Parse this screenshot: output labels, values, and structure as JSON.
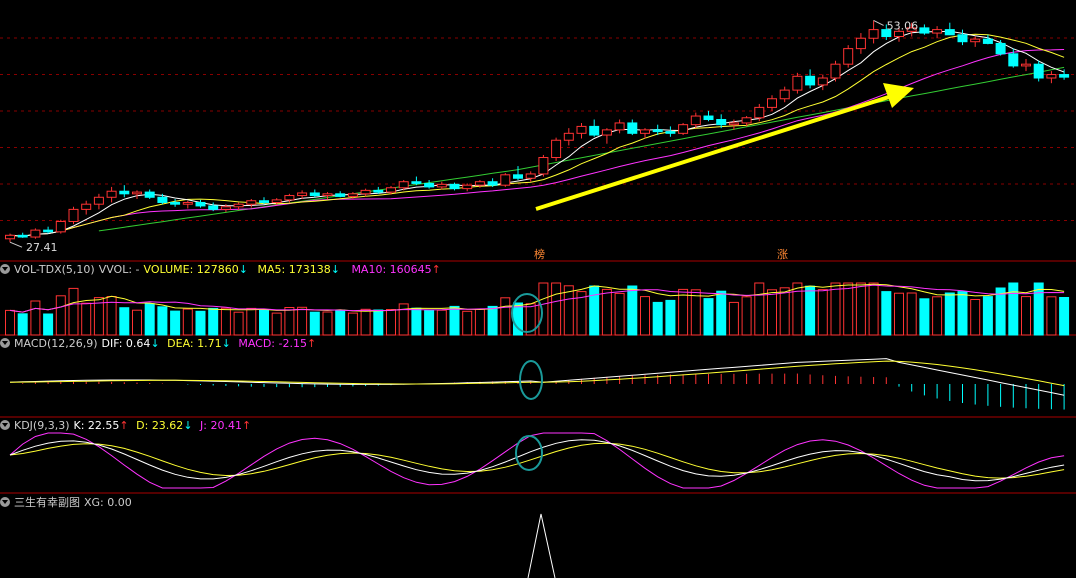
{
  "colors": {
    "up": "#ff3333",
    "down": "#00ffff",
    "ma5": "#ffffff",
    "ma10": "#ffff33",
    "ma20": "#ff33ff",
    "ma60": "#33cc33",
    "arrow": "#ffff00",
    "circle": "#1a9a9a",
    "divider": "#aa0000"
  },
  "price": {
    "high_label": "53.06",
    "low_label": "27.41",
    "markers": [
      "榜",
      "涨"
    ],
    "candles": [
      [
        27.8,
        28.4,
        27.4,
        28.2
      ],
      [
        28.2,
        28.5,
        27.9,
        28.0
      ],
      [
        28.0,
        29.0,
        27.8,
        28.8
      ],
      [
        28.8,
        29.2,
        28.4,
        28.6
      ],
      [
        28.6,
        30.0,
        28.4,
        29.8
      ],
      [
        29.8,
        31.5,
        29.5,
        31.2
      ],
      [
        31.2,
        32.2,
        30.6,
        31.8
      ],
      [
        31.8,
        33.0,
        31.2,
        32.6
      ],
      [
        32.6,
        33.8,
        32.0,
        33.3
      ],
      [
        33.3,
        34.0,
        32.6,
        33.0
      ],
      [
        33.0,
        33.4,
        32.4,
        33.2
      ],
      [
        33.2,
        33.5,
        32.4,
        32.6
      ],
      [
        32.6,
        33.0,
        31.8,
        32.0
      ],
      [
        32.0,
        32.4,
        31.5,
        31.8
      ],
      [
        31.8,
        32.2,
        31.3,
        32.0
      ],
      [
        32.0,
        32.3,
        31.4,
        31.6
      ],
      [
        31.6,
        32.0,
        31.0,
        31.2
      ],
      [
        31.2,
        31.8,
        30.9,
        31.5
      ],
      [
        31.5,
        32.0,
        31.1,
        31.8
      ],
      [
        31.8,
        32.4,
        31.4,
        32.2
      ],
      [
        32.2,
        32.6,
        31.8,
        32.0
      ],
      [
        32.0,
        32.5,
        31.7,
        32.3
      ],
      [
        32.3,
        33.0,
        32.0,
        32.8
      ],
      [
        32.8,
        33.4,
        32.4,
        33.1
      ],
      [
        33.1,
        33.5,
        32.6,
        32.8
      ],
      [
        32.8,
        33.2,
        32.4,
        33.0
      ],
      [
        33.0,
        33.3,
        32.6,
        32.7
      ],
      [
        32.7,
        33.2,
        32.4,
        33.0
      ],
      [
        33.0,
        33.6,
        32.7,
        33.4
      ],
      [
        33.4,
        33.8,
        33.0,
        33.2
      ],
      [
        33.2,
        33.9,
        32.9,
        33.7
      ],
      [
        33.7,
        34.6,
        33.4,
        34.4
      ],
      [
        34.4,
        35.0,
        34.0,
        34.2
      ],
      [
        34.2,
        34.6,
        33.6,
        33.8
      ],
      [
        33.8,
        34.4,
        33.5,
        34.1
      ],
      [
        34.1,
        34.3,
        33.4,
        33.6
      ],
      [
        33.6,
        34.2,
        33.3,
        34.0
      ],
      [
        34.0,
        34.6,
        33.7,
        34.4
      ],
      [
        34.4,
        34.8,
        33.8,
        34.0
      ],
      [
        34.0,
        35.4,
        33.8,
        35.2
      ],
      [
        35.2,
        36.2,
        34.6,
        34.8
      ],
      [
        34.8,
        35.6,
        34.4,
        35.3
      ],
      [
        35.3,
        37.5,
        35.0,
        37.2
      ],
      [
        37.2,
        39.5,
        36.8,
        39.2
      ],
      [
        39.2,
        40.6,
        38.6,
        40.0
      ],
      [
        40.0,
        41.2,
        39.4,
        40.8
      ],
      [
        40.8,
        41.6,
        39.6,
        39.8
      ],
      [
        39.8,
        40.6,
        38.8,
        40.4
      ],
      [
        40.4,
        41.6,
        40.0,
        41.2
      ],
      [
        41.2,
        41.6,
        39.8,
        40.0
      ],
      [
        40.0,
        40.6,
        39.4,
        40.4
      ],
      [
        40.4,
        41.0,
        39.8,
        40.2
      ],
      [
        40.2,
        40.8,
        39.6,
        40.0
      ],
      [
        40.0,
        41.2,
        39.8,
        41.0
      ],
      [
        41.0,
        42.4,
        40.6,
        42.0
      ],
      [
        42.0,
        42.6,
        41.4,
        41.6
      ],
      [
        41.6,
        42.2,
        40.6,
        41.0
      ],
      [
        41.0,
        41.6,
        40.4,
        41.2
      ],
      [
        41.2,
        42.0,
        40.8,
        41.8
      ],
      [
        41.8,
        43.4,
        41.4,
        43.0
      ],
      [
        43.0,
        44.4,
        42.6,
        44.0
      ],
      [
        44.0,
        45.4,
        43.6,
        45.0
      ],
      [
        45.0,
        47.0,
        44.6,
        46.6
      ],
      [
        46.6,
        47.4,
        45.2,
        45.6
      ],
      [
        45.6,
        46.8,
        45.0,
        46.4
      ],
      [
        46.4,
        48.4,
        46.0,
        48.0
      ],
      [
        48.0,
        50.2,
        47.6,
        49.8
      ],
      [
        49.8,
        51.6,
        49.2,
        51.0
      ],
      [
        51.0,
        53.06,
        50.4,
        52.0
      ],
      [
        52.0,
        52.6,
        50.8,
        51.2
      ],
      [
        51.2,
        52.2,
        50.6,
        51.8
      ],
      [
        51.8,
        52.8,
        51.2,
        52.2
      ],
      [
        52.2,
        52.6,
        51.4,
        51.6
      ],
      [
        51.6,
        52.4,
        51.0,
        52.0
      ],
      [
        52.0,
        52.8,
        51.4,
        51.4
      ],
      [
        51.4,
        52.0,
        50.2,
        50.6
      ],
      [
        50.6,
        51.2,
        50.0,
        50.9
      ],
      [
        50.9,
        51.4,
        50.3,
        50.4
      ],
      [
        50.4,
        50.8,
        49.0,
        49.2
      ],
      [
        49.2,
        49.8,
        47.6,
        47.8
      ],
      [
        47.8,
        48.6,
        47.2,
        48.0
      ],
      [
        48.0,
        48.4,
        46.0,
        46.4
      ],
      [
        46.4,
        47.2,
        45.8,
        46.8
      ],
      [
        46.8,
        47.4,
        46.2,
        46.5
      ]
    ]
  },
  "volume": {
    "label": "VOL-TDX(5,10)",
    "vvol": "VVOL: -",
    "volume": "VOLUME: 127860",
    "volume_arrow": "↓",
    "ma5": "MA5: 173138",
    "ma5_arrow": "↓",
    "ma10": "MA10: 160645",
    "ma10_arrow": "↑"
  },
  "macd": {
    "label": "MACD(12,26,9)",
    "dif": "DIF: 0.64",
    "dif_arrow": "↓",
    "dea": "DEA: 1.71",
    "dea_arrow": "↓",
    "macd": "MACD: -2.15",
    "macd_arrow": "↑"
  },
  "kdj": {
    "label": "KDJ(9,3,3)",
    "k": "K: 22.55",
    "k_arrow": "↑",
    "d": "D: 23.62",
    "d_arrow": "↓",
    "j": "J: 20.41",
    "j_arrow": "↑"
  },
  "sub": {
    "label": "三生有幸副图",
    "xg": "XG: 0.00"
  }
}
